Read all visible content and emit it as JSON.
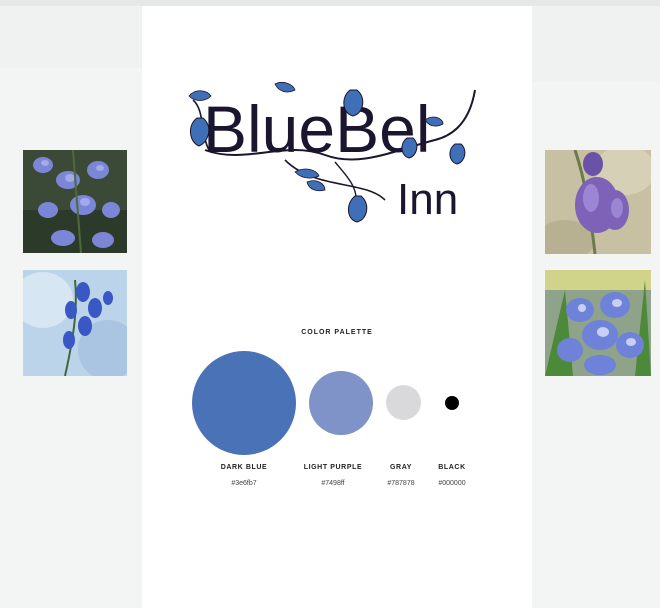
{
  "brand": {
    "name_part1": "BlueBel",
    "name_part2": "Inn",
    "ink_color": "#1b1530",
    "flower_color": "#3e6fb7"
  },
  "palette": {
    "title": "COLOR PALETTE",
    "swatches": [
      {
        "label": "DARK BLUE",
        "hex": "#3e6fb7"
      },
      {
        "label": "LIGHT PURPLE",
        "hex": "#7498ff"
      },
      {
        "label": "GRAY",
        "hex": "#787878"
      },
      {
        "label": "BLACK",
        "hex": "#000000"
      }
    ]
  },
  "photos": [
    "bluebell-photo",
    "bluebell-photo",
    "bluebell-photo",
    "bluebell-photo"
  ]
}
